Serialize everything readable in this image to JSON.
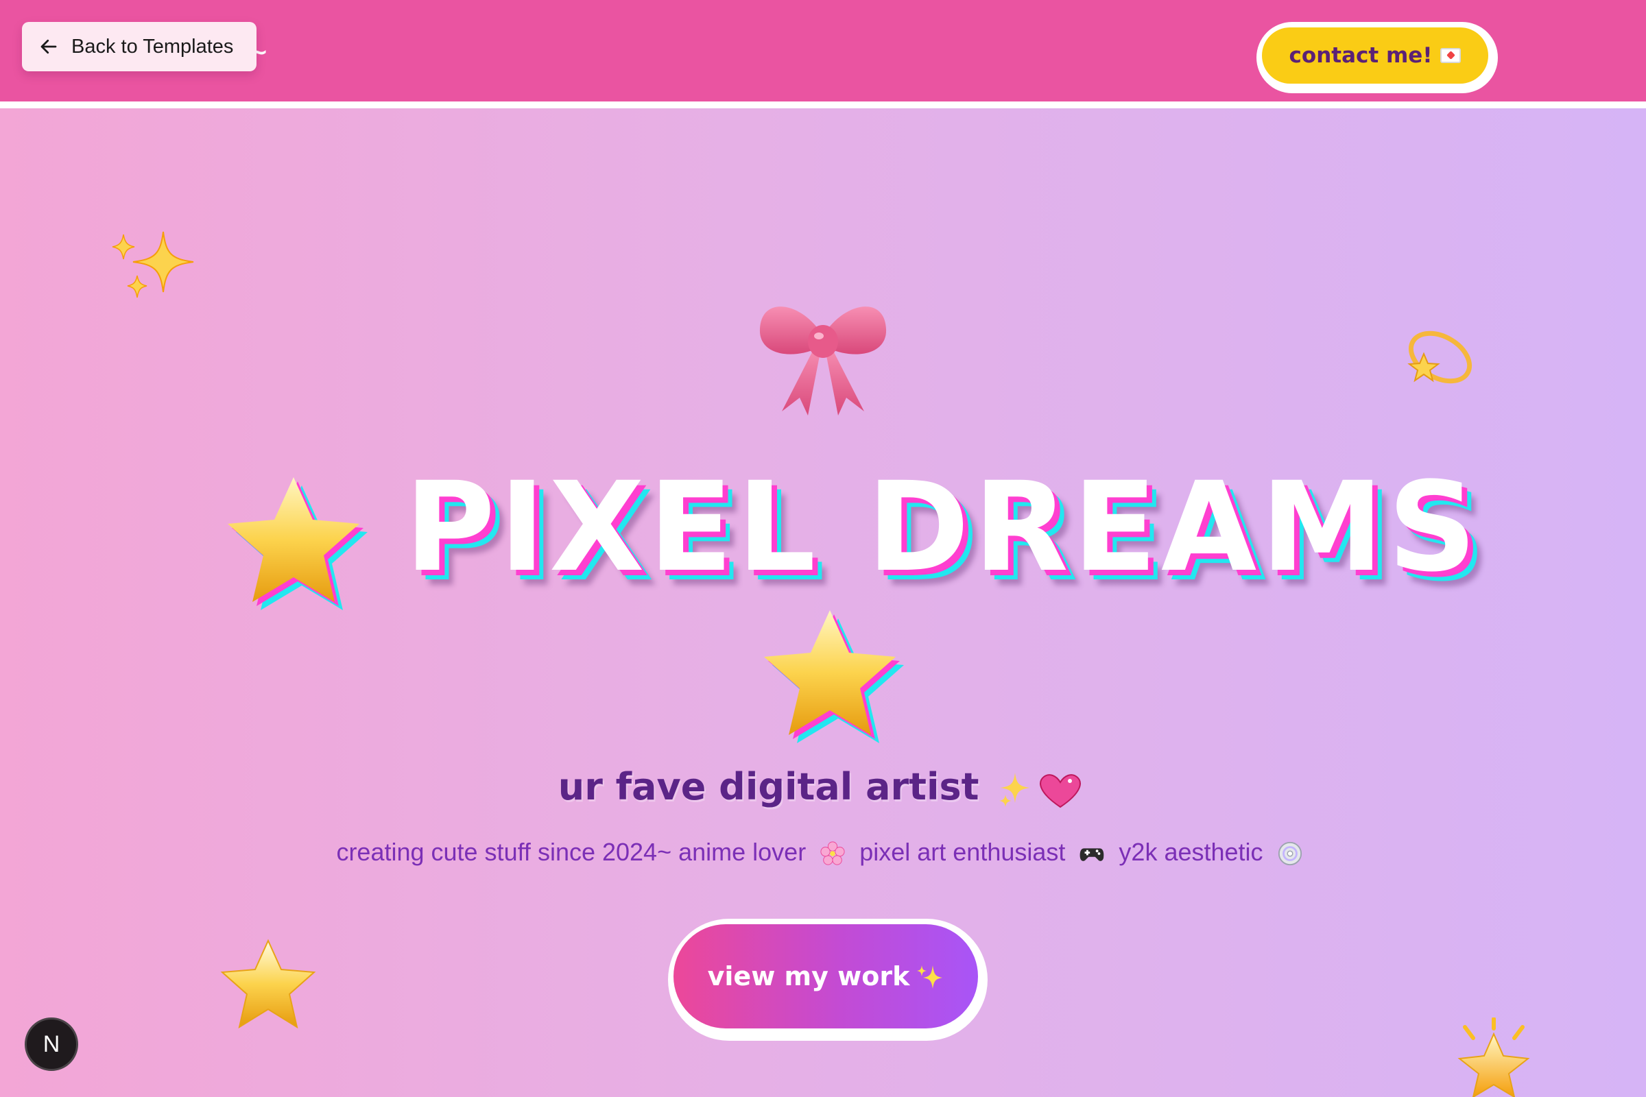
{
  "header": {
    "brand_peek": "k~",
    "back_button_label": "Back to Templates",
    "contact_label": "contact me!",
    "contact_icon": "love-letter-icon"
  },
  "hero": {
    "title": "PIXEL DREAMS",
    "title_icons": [
      "star-icon",
      "star-icon"
    ],
    "subtitle": "ur fave digital artist",
    "subtitle_icons": [
      "sparkles-icon",
      "sparkling-heart-icon"
    ],
    "tagline_parts": [
      "creating cute stuff since 2024~ anime lover",
      "pixel art enthusiast",
      "y2k aesthetic"
    ],
    "tagline_icons": [
      "cherry-blossom-icon",
      "game-controller-icon",
      "dvd-icon"
    ],
    "cta_label": "view my work",
    "cta_icon": "sparkles-icon"
  },
  "decorations": [
    "sparkles-icon",
    "ribbon-bow-icon",
    "dizzy-star-icon",
    "star-icon",
    "glowing-star-icon"
  ],
  "dev_badge": {
    "label": "N"
  },
  "colors": {
    "header_bg": "#ea54a1",
    "contact_bg": "#facc15",
    "cta_gradient_start": "#ec4899",
    "cta_gradient_end": "#a855f7",
    "subtitle_text": "#5b2487",
    "tagline_text": "#7b2fb6"
  }
}
